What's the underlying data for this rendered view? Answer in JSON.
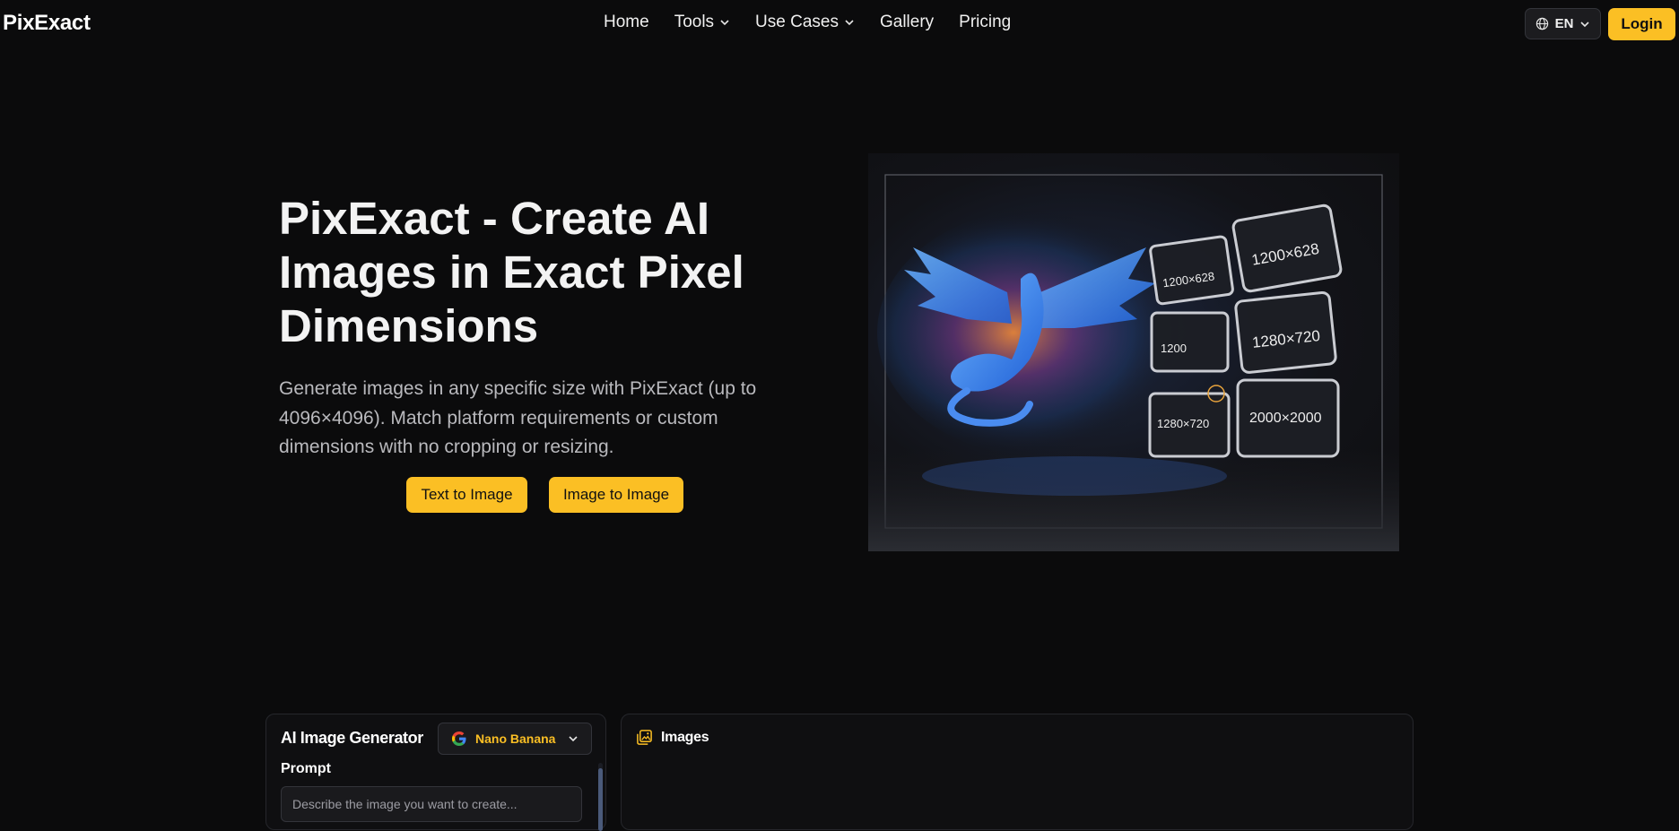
{
  "brand": {
    "name": "PixExact",
    "accent": "#fbbf24"
  },
  "nav": {
    "items": [
      {
        "label": "Home",
        "dropdown": false
      },
      {
        "label": "Tools",
        "dropdown": true
      },
      {
        "label": "Use Cases",
        "dropdown": true
      },
      {
        "label": "Gallery",
        "dropdown": false
      },
      {
        "label": "Pricing",
        "dropdown": false
      }
    ],
    "language": "EN",
    "login_label": "Login"
  },
  "hero": {
    "title": "PixExact - Create AI Images in Exact Pixel Dimensions",
    "subtitle": "Generate images in any specific size with PixExact (up to 4096×4096). Match platform requirements or custom dimensions with no cropping or resizing.",
    "cta_text_to_image": "Text to Image",
    "cta_image_to_image": "Image to Image",
    "image_labels": [
      "1200×628",
      "1200×628",
      "1200",
      "1280×720",
      "1280×720",
      "2000×2000"
    ]
  },
  "generator": {
    "title": "AI Image Generator",
    "model": "Nano Banana",
    "prompt_label": "Prompt",
    "prompt_placeholder": "Describe the image you want to create..."
  },
  "images_panel": {
    "title": "Images"
  }
}
